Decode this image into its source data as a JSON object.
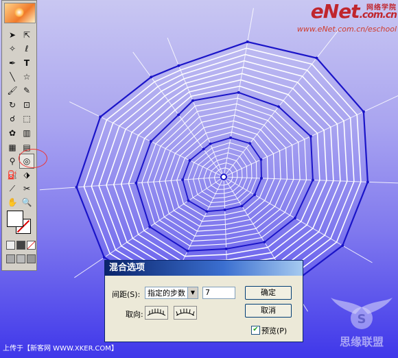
{
  "brand": {
    "logo_text": "eNet",
    "logo_suffix": ".com.cn",
    "logo_cn": "网络学院",
    "url": "www.eNet.com.cn/eschool"
  },
  "toolbox": {
    "tools": [
      "selection",
      "direct-selection",
      "magic-wand",
      "lasso",
      "pen",
      "type",
      "line",
      "star",
      "paintbrush",
      "pencil",
      "rotate",
      "scale",
      "warp",
      "free-transform",
      "symbol-sprayer",
      "column-graph",
      "mesh",
      "gradient",
      "eyedropper",
      "blend",
      "live-paint-bucket",
      "live-paint-selection",
      "slice",
      "scissors",
      "hand",
      "zoom"
    ],
    "active_tool": "blend",
    "fill_color": "#ffffff",
    "stroke_color": "#ffffff"
  },
  "dialog": {
    "title": "混合选项",
    "spacing_label": "间距(S):",
    "spacing_mode": "指定的步数",
    "steps_value": "7",
    "orientation_label": "取向:",
    "ok_label": "确定",
    "cancel_label": "取消",
    "preview_label": "预览(P)",
    "preview_checked": true
  },
  "footer": {
    "text": "上传于【新客网 WWW.XKER.COM】"
  },
  "colors": {
    "web_outer": "#1a14c8",
    "web_inner": "#ffffff",
    "background_top": "#c9c7f2",
    "background_bottom": "#3f37ea"
  }
}
